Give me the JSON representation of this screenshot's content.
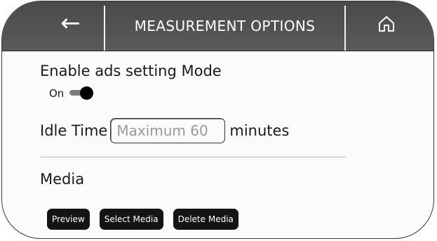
{
  "header": {
    "title": "MEASUREMENT OPTIONS",
    "back_icon": "arrow-left-icon",
    "back_glyph": "←",
    "home_icon": "home-icon"
  },
  "ads_setting": {
    "label": "Enable ads setting Mode",
    "toggle_label": "On",
    "toggle_state": true
  },
  "idle_time": {
    "label": "Idle Time",
    "placeholder": "Maximum 60",
    "value": "",
    "unit": "minutes"
  },
  "media": {
    "label": "Media",
    "buttons": [
      "Preview",
      "Select Media",
      "Delete Media"
    ]
  },
  "colors": {
    "header_bg": "#4f4f4f",
    "button_bg": "#141414",
    "toggle_knob": "#000000",
    "toggle_track": "#7d7d7d"
  }
}
